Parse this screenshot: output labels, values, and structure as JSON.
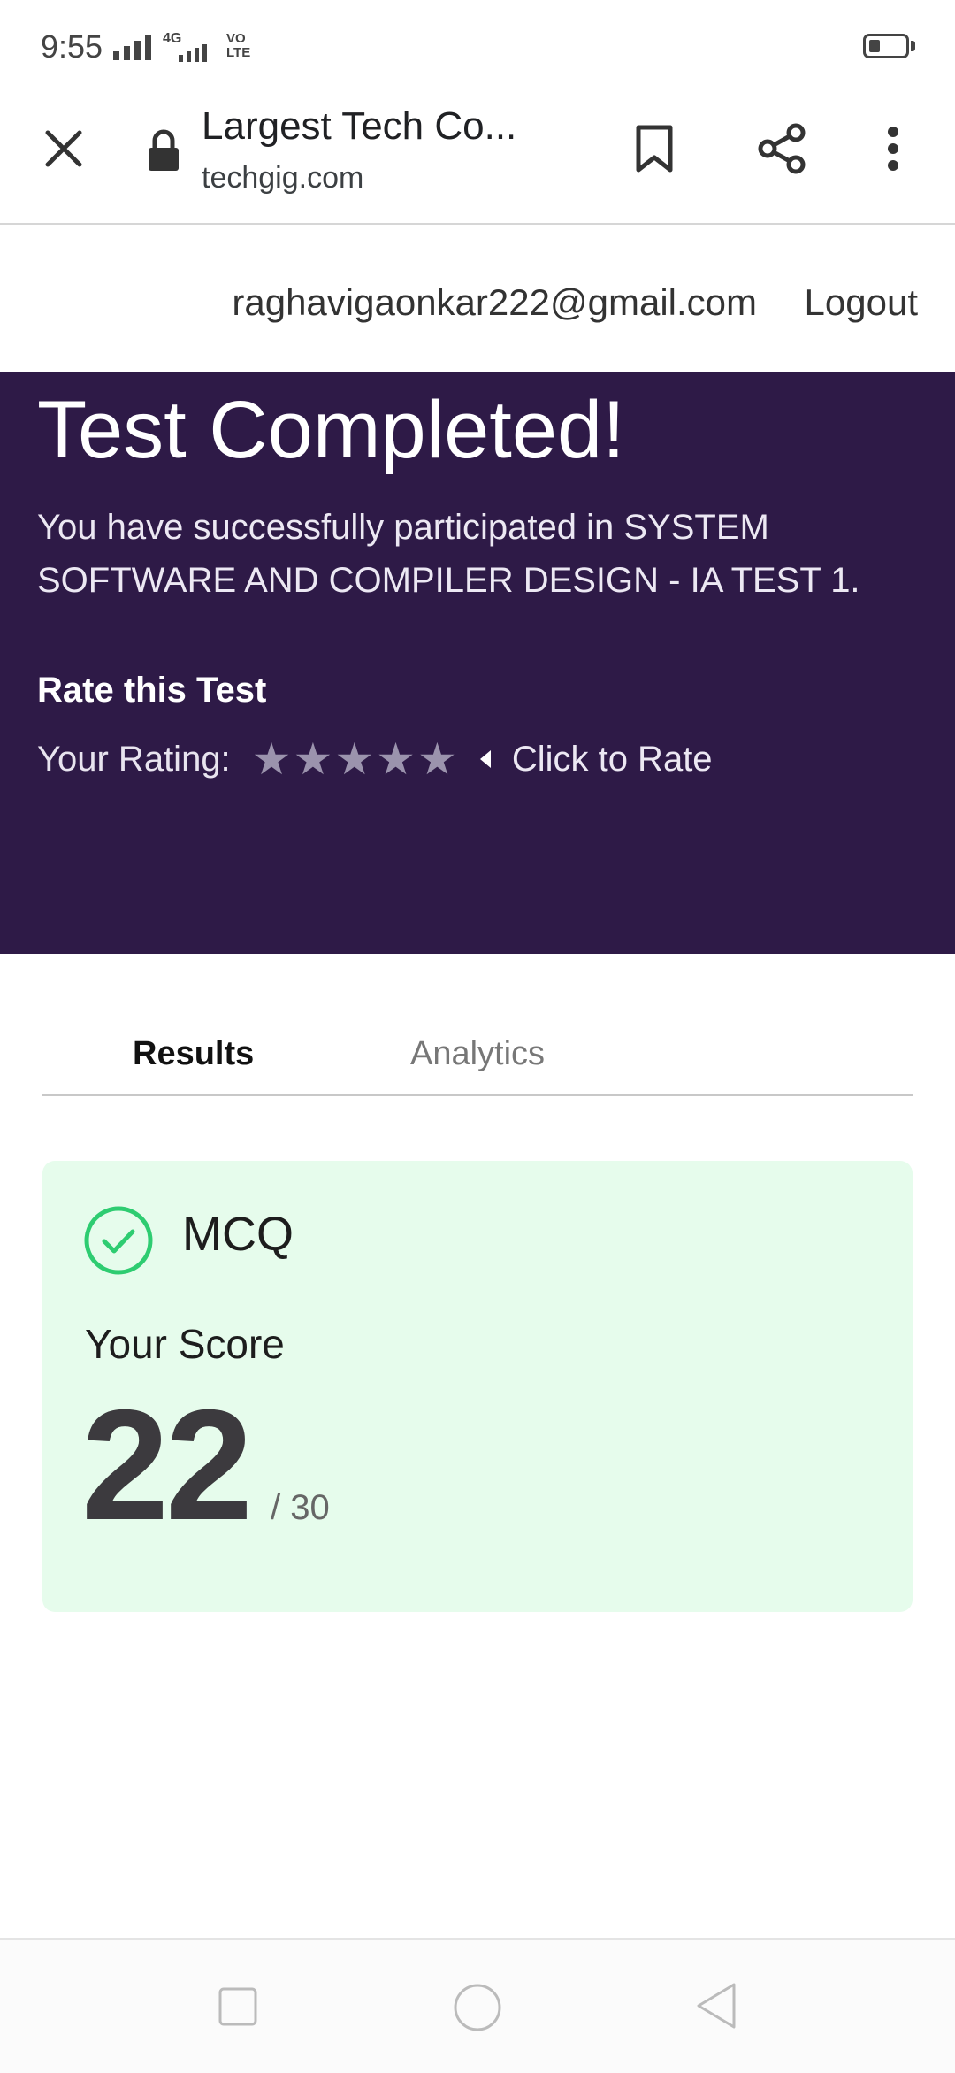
{
  "status_bar": {
    "time": "9:55",
    "network_label": "4G",
    "volte_label": "VO LTE"
  },
  "browser": {
    "page_title": "Largest Tech Co...",
    "domain": "techgig.com",
    "icons": [
      "close-icon",
      "lock-icon",
      "bookmark-icon",
      "share-icon",
      "more-vert-icon"
    ]
  },
  "account": {
    "email": "raghavigaonkar222@gmail.com",
    "logout_label": "Logout"
  },
  "hero": {
    "title": "Test Completed!",
    "message": "You have successfully participated in SYSTEM SOFTWARE AND COMPILER DESIGN - IA TEST 1.",
    "rate_heading": "Rate this Test",
    "rating_label": "Your Rating:",
    "stars": [
      "★",
      "★",
      "★",
      "★",
      "★"
    ],
    "click_to_rate": "Click to Rate",
    "bg_color": "#2e1a47"
  },
  "tabs": [
    {
      "label": "Results",
      "active": true
    },
    {
      "label": "Analytics",
      "active": false
    }
  ],
  "score_card": {
    "section": "MCQ",
    "score_label": "Your Score",
    "score": "22",
    "total": "/ 30",
    "accent_color": "#2ecc71",
    "bg_color": "#e6fcec"
  },
  "nav_bar": {
    "buttons": [
      "recent-apps-icon",
      "home-icon",
      "back-icon"
    ]
  }
}
